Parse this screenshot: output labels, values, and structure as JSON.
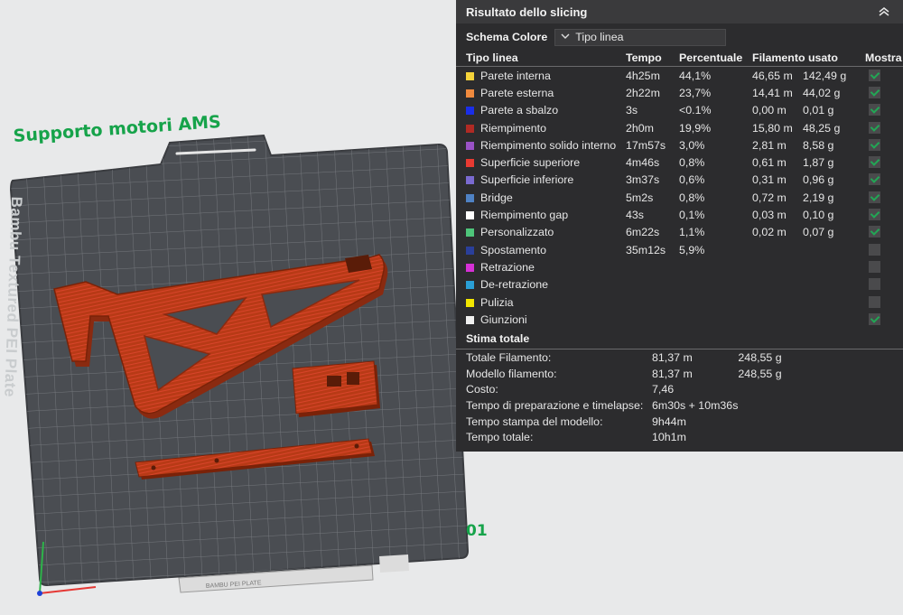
{
  "plate": {
    "title": "Supporto motori AMS",
    "brand_text": "Bambu Textured PEI Plate",
    "plate_number": "01",
    "label_strip": "BAMBU PEI PLATE",
    "model_color": "#b83a16",
    "plate_color": "#4a4d52"
  },
  "panel": {
    "title": "Risultato dello slicing",
    "collapse_icon": "double-chevron-up-icon",
    "scheme_label": "Schema Colore",
    "scheme_value": "Tipo linea",
    "headers": {
      "type": "Tipo linea",
      "time": "Tempo",
      "percent": "Percentuale",
      "filament": "Filamento usato",
      "show": "Mostra"
    },
    "rows": [
      {
        "name": "Parete interna",
        "color": "#f5d33a",
        "time": "4h25m",
        "percent": "44,1%",
        "length": "46,65 m",
        "weight": "142,49 g",
        "show": true
      },
      {
        "name": "Parete esterna",
        "color": "#f08a3e",
        "time": "2h22m",
        "percent": "23,7%",
        "length": "14,41 m",
        "weight": "44,02 g",
        "show": true
      },
      {
        "name": "Parete a sbalzo",
        "color": "#1a2ee8",
        "time": "3s",
        "percent": "<0.1%",
        "length": "0,00 m",
        "weight": "0,01 g",
        "show": true
      },
      {
        "name": "Riempimento",
        "color": "#b02a24",
        "time": "2h0m",
        "percent": "19,9%",
        "length": "15,80 m",
        "weight": "48,25 g",
        "show": true
      },
      {
        "name": "Riempimento solido interno",
        "color": "#9a52c6",
        "time": "17m57s",
        "percent": "3,0%",
        "length": "2,81 m",
        "weight": "8,58 g",
        "show": true
      },
      {
        "name": "Superficie superiore",
        "color": "#e83a32",
        "time": "4m46s",
        "percent": "0,8%",
        "length": "0,61 m",
        "weight": "1,87 g",
        "show": true
      },
      {
        "name": "Superficie inferiore",
        "color": "#7a6ad0",
        "time": "3m37s",
        "percent": "0,6%",
        "length": "0,31 m",
        "weight": "0,96 g",
        "show": true
      },
      {
        "name": "Bridge",
        "color": "#4f82c4",
        "time": "5m2s",
        "percent": "0,8%",
        "length": "0,72 m",
        "weight": "2,19 g",
        "show": true
      },
      {
        "name": "Riempimento gap",
        "color": "#ffffff",
        "time": "43s",
        "percent": "0,1%",
        "length": "0,03 m",
        "weight": "0,10 g",
        "show": true
      },
      {
        "name": "Personalizzato",
        "color": "#4ec57a",
        "time": "6m22s",
        "percent": "1,1%",
        "length": "0,02 m",
        "weight": "0,07 g",
        "show": true
      },
      {
        "name": "Spostamento",
        "color": "#2a3f9a",
        "time": "35m12s",
        "percent": "5,9%",
        "length": "",
        "weight": "",
        "show": false
      },
      {
        "name": "Retrazione",
        "color": "#d630d6",
        "time": "",
        "percent": "",
        "length": "",
        "weight": "",
        "show": false
      },
      {
        "name": "De-retrazione",
        "color": "#2a9fd6",
        "time": "",
        "percent": "",
        "length": "",
        "weight": "",
        "show": false
      },
      {
        "name": "Pulizia",
        "color": "#f2e600",
        "time": "",
        "percent": "",
        "length": "",
        "weight": "",
        "show": false
      },
      {
        "name": "Giunzioni",
        "color": "#f0f0f0",
        "time": "",
        "percent": "",
        "length": "",
        "weight": "",
        "show": true
      }
    ],
    "estimate": {
      "title": "Stima totale",
      "rows": [
        {
          "label": "Totale Filamento:",
          "v1": "81,37 m",
          "v2": "248,55 g"
        },
        {
          "label": "Modello filamento:",
          "v1": "81,37 m",
          "v2": "248,55 g"
        },
        {
          "label": "Costo:",
          "v1": "7,46",
          "v2": ""
        },
        {
          "label": "Tempo di preparazione e timelapse:",
          "v1": "6m30s + 10m36s",
          "v2": ""
        },
        {
          "label": "Tempo stampa del modello:",
          "v1": "9h44m",
          "v2": ""
        },
        {
          "label": "Tempo totale:",
          "v1": "10h1m",
          "v2": ""
        }
      ]
    }
  }
}
